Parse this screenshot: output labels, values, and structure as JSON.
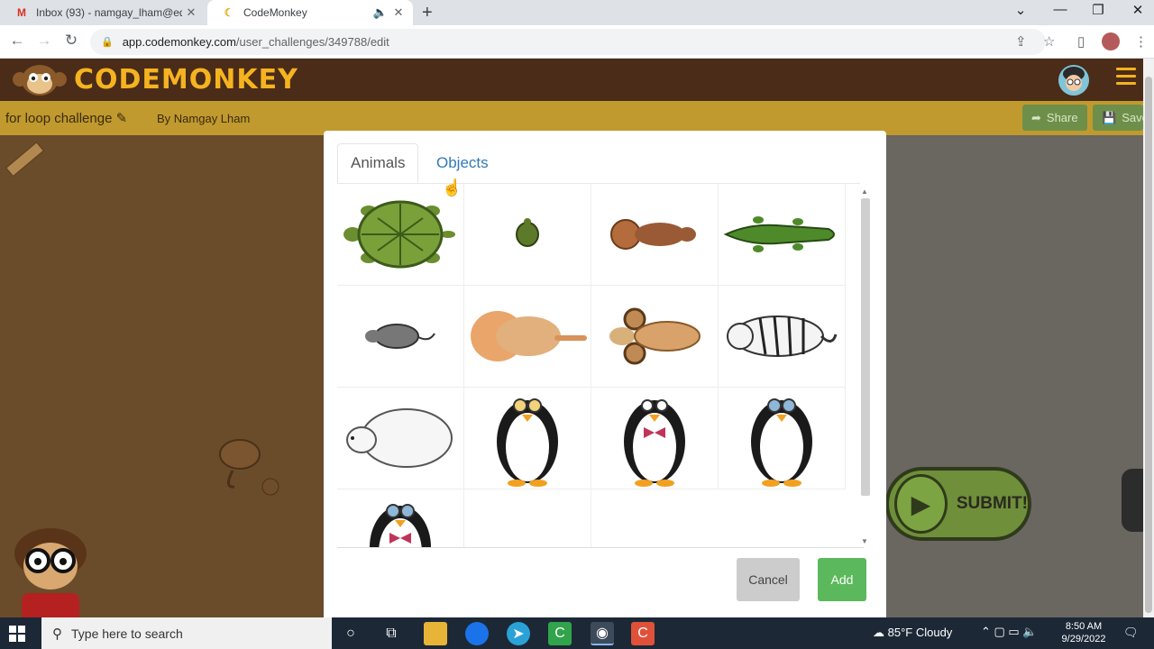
{
  "browser": {
    "tabs": [
      {
        "title": "Inbox (93) - namgay_lham@educ",
        "favicon": "gmail-icon",
        "active": false
      },
      {
        "title": "CodeMonkey",
        "favicon": "codemonkey-banana-icon",
        "active": true
      }
    ],
    "url_domain": "app.codemonkey.com",
    "url_path": "/user_challenges/349788/edit"
  },
  "app": {
    "logo_text": "CODEMONKEY",
    "challenge_title": "for loop challenge",
    "author": "By Namgay Lham",
    "share_label": "Share",
    "save_label": "Save",
    "submit_label": "SUBMIT!"
  },
  "modal": {
    "tabs": [
      "Animals",
      "Objects"
    ],
    "active_tab": "Animals",
    "items": [
      "turtle",
      "small-turtle",
      "beaver",
      "crocodile",
      "rat",
      "lion",
      "ram",
      "tiger",
      "polar-bear",
      "penguin-goggles-orange",
      "penguin-bowtie",
      "penguin-goggles-blue",
      "penguin-goggles-bowtie"
    ],
    "cancel_label": "Cancel",
    "add_label": "Add"
  },
  "taskbar": {
    "search_placeholder": "Type here to search",
    "weather": "85°F  Cloudy",
    "time": "8:50 AM",
    "date": "9/29/2022"
  },
  "colors": {
    "header_brown": "#4a2c18",
    "logo_gold": "#f5b320",
    "subbar_gold": "#c09a2e",
    "link_blue": "#337ab7",
    "add_green": "#5cb85c"
  }
}
